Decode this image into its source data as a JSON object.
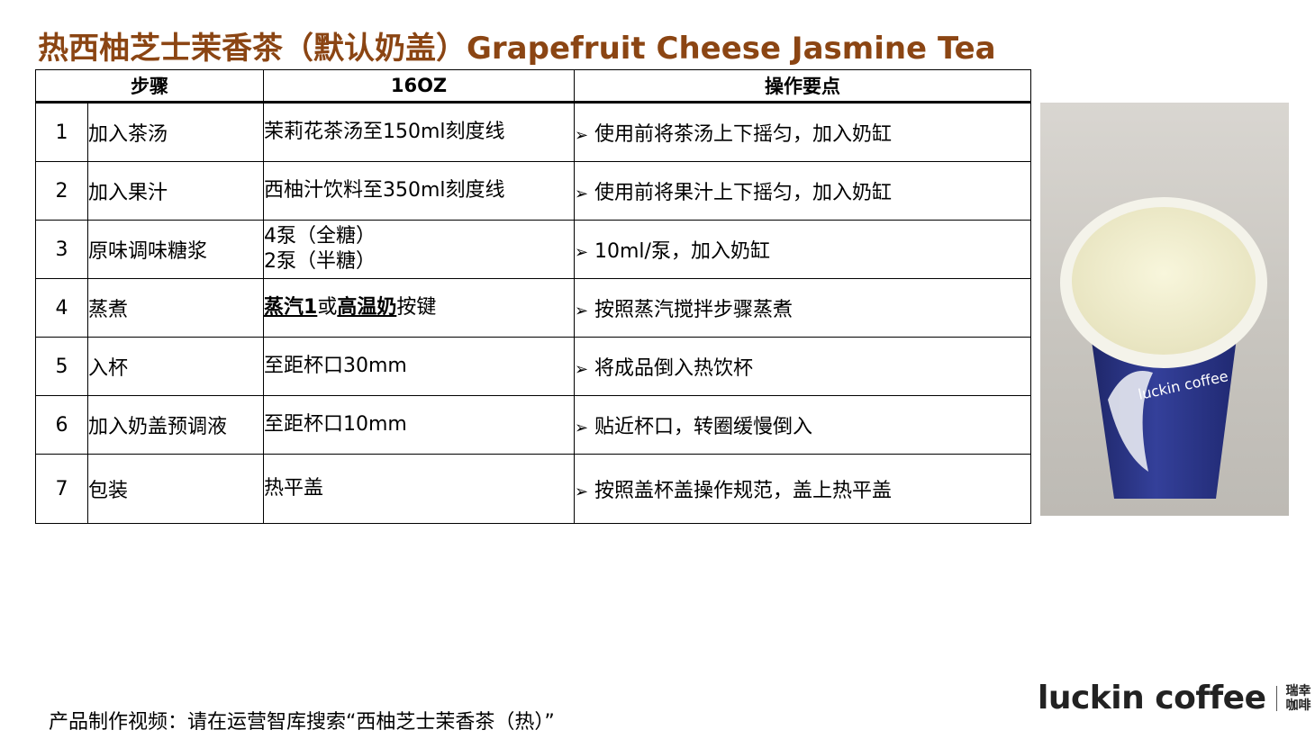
{
  "title": "热西柚芝士茉香茶（默认奶盖）Grapefruit Cheese Jasmine Tea",
  "table": {
    "headers": {
      "step": "步骤",
      "size": "16OZ",
      "notes": "操作要点"
    },
    "rows": [
      {
        "num": "1",
        "step": "加入茶汤",
        "spec": "茉莉花茶汤至150ml刻度线",
        "note": "使用前将茶汤上下摇匀，加入奶缸"
      },
      {
        "num": "2",
        "step": "加入果汁",
        "spec": "西柚汁饮料至350ml刻度线",
        "note": "使用前将果汁上下摇匀，加入奶缸"
      },
      {
        "num": "3",
        "step": "原味调味糖浆",
        "spec_line1": "4泵（全糖）",
        "spec_line2": "2泵（半糖）",
        "note": "10ml/泵，加入奶缸"
      },
      {
        "num": "4",
        "step": "蒸煮",
        "spec_bold1": "蒸汽1",
        "spec_mid": "或",
        "spec_bold2": "高温奶",
        "spec_end": "按键",
        "note": "按照蒸汽搅拌步骤蒸煮"
      },
      {
        "num": "5",
        "step": "入杯",
        "spec": "至距杯口30mm",
        "note": "将成品倒入热饮杯"
      },
      {
        "num": "6",
        "step": "加入奶盖预调液",
        "spec": "至距杯口10mm",
        "note": "贴近杯口，转圈缓慢倒入"
      },
      {
        "num": "7",
        "step": "包装",
        "spec": "热平盖",
        "note": "按照盖杯盖操作规范，盖上热平盖"
      }
    ]
  },
  "photo": {
    "cup_text": "luckin coffee"
  },
  "footer": "产品制作视频：请在运营智库搜索“西柚芝士茉香茶（热）”",
  "brand": {
    "en": "luckin coffee",
    "cn_line1": "瑞幸",
    "cn_line2": "咖啡"
  },
  "colors": {
    "title": "#8b4513",
    "cup_blue": "#2b3586",
    "foam": "#f2efd0"
  }
}
